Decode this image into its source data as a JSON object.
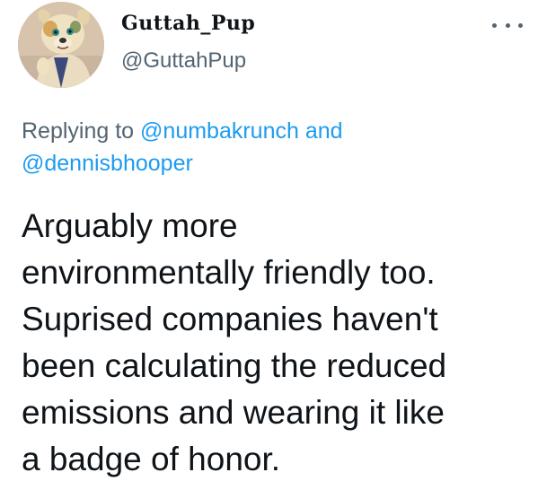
{
  "user": {
    "display_name": "Guttah_Pup",
    "handle": "@GuttahPup"
  },
  "reply": {
    "prefix": "Replying to",
    "mention_1": "@numbakrunch",
    "conjunction": "and",
    "mention_2": "@dennisbhooper"
  },
  "tweet": {
    "lines": [
      "Arguably more",
      "environmentally friendly too.",
      "Suprised companies haven't",
      "been calculating the reduced",
      "emissions and wearing it like",
      "a badge of honor."
    ]
  },
  "colors": {
    "link": "#1d9bf0",
    "secondary_text": "#536471",
    "primary_text": "#0f1419"
  },
  "icons": {
    "more": "more-horizontal-icon"
  }
}
